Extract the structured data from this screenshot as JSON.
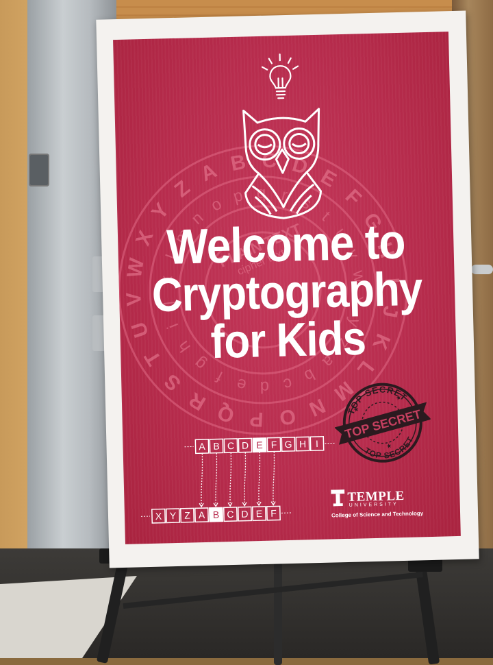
{
  "sign": {
    "headline": {
      "line1": "Welcome to",
      "line2": "Cryptography",
      "line3": "for Kids"
    },
    "stamp": {
      "top_text": "TOP SECRET",
      "banner_text": "TOP SECRET",
      "bottom_text": "TOP SECRET"
    },
    "wheel": {
      "outer_letters": [
        "X",
        "Y",
        "Z",
        "A",
        "B",
        "C",
        "D",
        "E",
        "F",
        "G",
        "H",
        "I",
        "J",
        "K",
        "L",
        "M",
        "N",
        "O",
        "P",
        "Q",
        "R",
        "S",
        "T",
        "U",
        "V",
        "W"
      ],
      "inner_letters": [
        "m",
        "n",
        "o",
        "p",
        "q",
        "r",
        "s",
        "t",
        "u",
        "v",
        "w",
        "x",
        "y",
        "z",
        "a",
        "b",
        "c",
        "d",
        "e",
        "f",
        "g",
        "h",
        "i",
        "j",
        "k",
        "l"
      ],
      "plain_label": "PLAIN TEXT",
      "cipher_label": "cipher text"
    },
    "cipher_rows": {
      "plain": [
        "A",
        "B",
        "C",
        "D",
        "E",
        "F",
        "G",
        "H",
        "I"
      ],
      "cipher": [
        "X",
        "Y",
        "Z",
        "A",
        "B",
        "C",
        "D",
        "E",
        "F"
      ],
      "highlight_plain": "E",
      "highlight_cipher": "B"
    },
    "logo": {
      "name": "TEMPLE",
      "sub": "UNIVERSITY",
      "college": "College of Science and Technology"
    },
    "icons": [
      "lightbulb-icon",
      "owl-icon",
      "cipher-wheel-graphic",
      "top-secret-stamp",
      "temple-t-icon"
    ],
    "colors": {
      "sign_red": "#b72c4d",
      "board_white": "#f4f2ef",
      "stamp_dark": "#2b1a1f"
    }
  }
}
